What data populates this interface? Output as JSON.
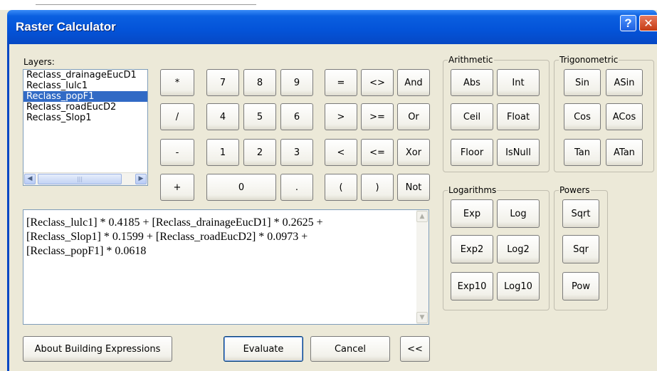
{
  "window": {
    "title": "Raster Calculator",
    "help_glyph": "?",
    "close_glyph": "✕"
  },
  "layers": {
    "label": "Layers:",
    "items": [
      "Reclass_drainageEucD1",
      "Reclass_lulc1",
      "Reclass_popF1",
      "Reclass_roadEucD2",
      "Reclass_Slop1"
    ],
    "selected": "Reclass_popF1",
    "scroll_left": "◀",
    "scroll_right": "▶",
    "thumb_grip": "|||"
  },
  "keypad": {
    "multiply": "*",
    "divide": "/",
    "minus": "-",
    "plus": "+",
    "seven": "7",
    "eight": "8",
    "nine": "9",
    "four": "4",
    "five": "5",
    "six": "6",
    "one": "1",
    "two": "2",
    "three": "3",
    "zero": "0",
    "dot": ".",
    "equals": "=",
    "not_equal": "<>",
    "and": "And",
    "greater": ">",
    "greater_equal": ">=",
    "or": "Or",
    "less": "<",
    "less_equal": "<=",
    "xor": "Xor",
    "open_paren": "(",
    "close_paren": ")",
    "not": "Not"
  },
  "arithmetic": {
    "label": "Arithmetic",
    "abs": "Abs",
    "int": "Int",
    "ceil": "Ceil",
    "float": "Float",
    "floor": "Floor",
    "isnull": "IsNull"
  },
  "trigonometric": {
    "label": "Trigonometric",
    "sin": "Sin",
    "asin": "ASin",
    "cos": "Cos",
    "acos": "ACos",
    "tan": "Tan",
    "atan": "ATan"
  },
  "logarithms": {
    "label": "Logarithms",
    "exp": "Exp",
    "log": "Log",
    "exp2": "Exp2",
    "log2": "Log2",
    "exp10": "Exp10",
    "log10": "Log10"
  },
  "powers": {
    "label": "Powers",
    "sqrt": "Sqrt",
    "sqr": "Sqr",
    "pow": "Pow"
  },
  "expression": {
    "text": "[Reclass_lulc1] * 0.4185 + [Reclass_drainageEucD1] * 0.2625 +\n[Reclass_Slop1] * 0.1599 + [Reclass_roadEucD2] * 0.0973 +\n[Reclass_popF1] * 0.0618",
    "scroll_up": "▲",
    "scroll_down": "▼"
  },
  "footer": {
    "about": "About Building Expressions",
    "evaluate": "Evaluate",
    "cancel": "Cancel",
    "collapse": "<<"
  }
}
